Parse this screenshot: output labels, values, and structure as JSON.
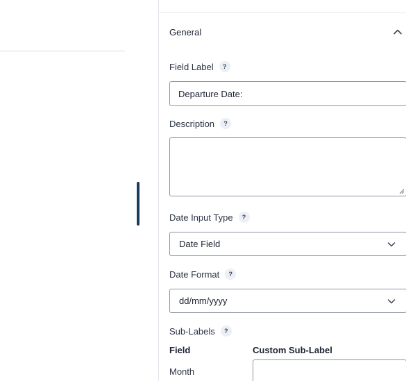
{
  "panel": {
    "section_title": "General",
    "field_label": {
      "label": "Field Label",
      "help": "?",
      "value": "Departure Date:"
    },
    "description": {
      "label": "Description",
      "help": "?",
      "value": ""
    },
    "date_input_type": {
      "label": "Date Input Type",
      "help": "?",
      "selected": "Date Field"
    },
    "date_format": {
      "label": "Date Format",
      "help": "?",
      "selected": "dd/mm/yyyy"
    },
    "sub_labels": {
      "label": "Sub-Labels",
      "help": "?",
      "col_field": "Field",
      "col_custom": "Custom Sub-Label",
      "rows": [
        {
          "field": "Month",
          "custom": ""
        }
      ]
    }
  },
  "colors": {
    "accent_handle": "#1a3d5c",
    "input_border": "#8c92a0",
    "help_bg": "#eceff5"
  }
}
